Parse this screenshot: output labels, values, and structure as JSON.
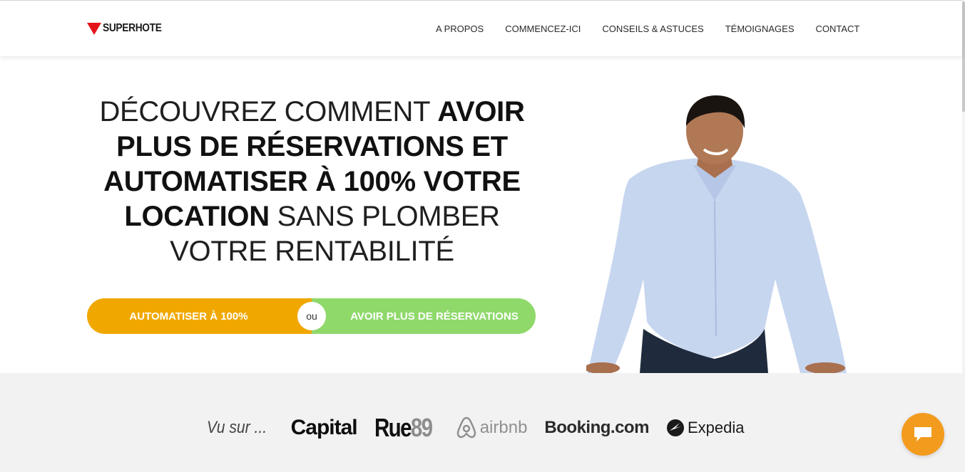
{
  "header": {
    "logo_text": "SUPERHOTE",
    "nav": [
      {
        "label": "A PROPOS"
      },
      {
        "label": "COMMENCEZ-ICI"
      },
      {
        "label": "CONSEILS & ASTUCES"
      },
      {
        "label": "TÉMOIGNAGES"
      },
      {
        "label": "CONTACT"
      }
    ]
  },
  "hero": {
    "headline_light_1": "DÉCOUVREZ COMMENT ",
    "headline_bold": "AVOIR PLUS DE RÉSERVATIONS ET AUTOMATISER À 100% VOTRE LOCATION",
    "headline_light_2": " SANS PLOMBER VOTRE RENTABILITÉ",
    "cta_left_label": "AUTOMATISER À 100%",
    "cta_or_label": "ou",
    "cta_right_label": "AVOIR PLUS DE RÉSERVATIONS"
  },
  "press": {
    "intro": "Vu sur ...",
    "logos": {
      "capital": "Capital",
      "rue_part1": "Rue",
      "rue_part2": "89",
      "airbnb": "airbnb",
      "booking": "Booking.com",
      "expedia": "Expedia"
    }
  },
  "chat": {
    "icon": "chat-bubble-icon"
  },
  "colors": {
    "accent_orange": "#f0a800",
    "accent_green": "#8fd96b",
    "logo_red": "#e3141b",
    "chat_orange": "#f29b1d"
  }
}
